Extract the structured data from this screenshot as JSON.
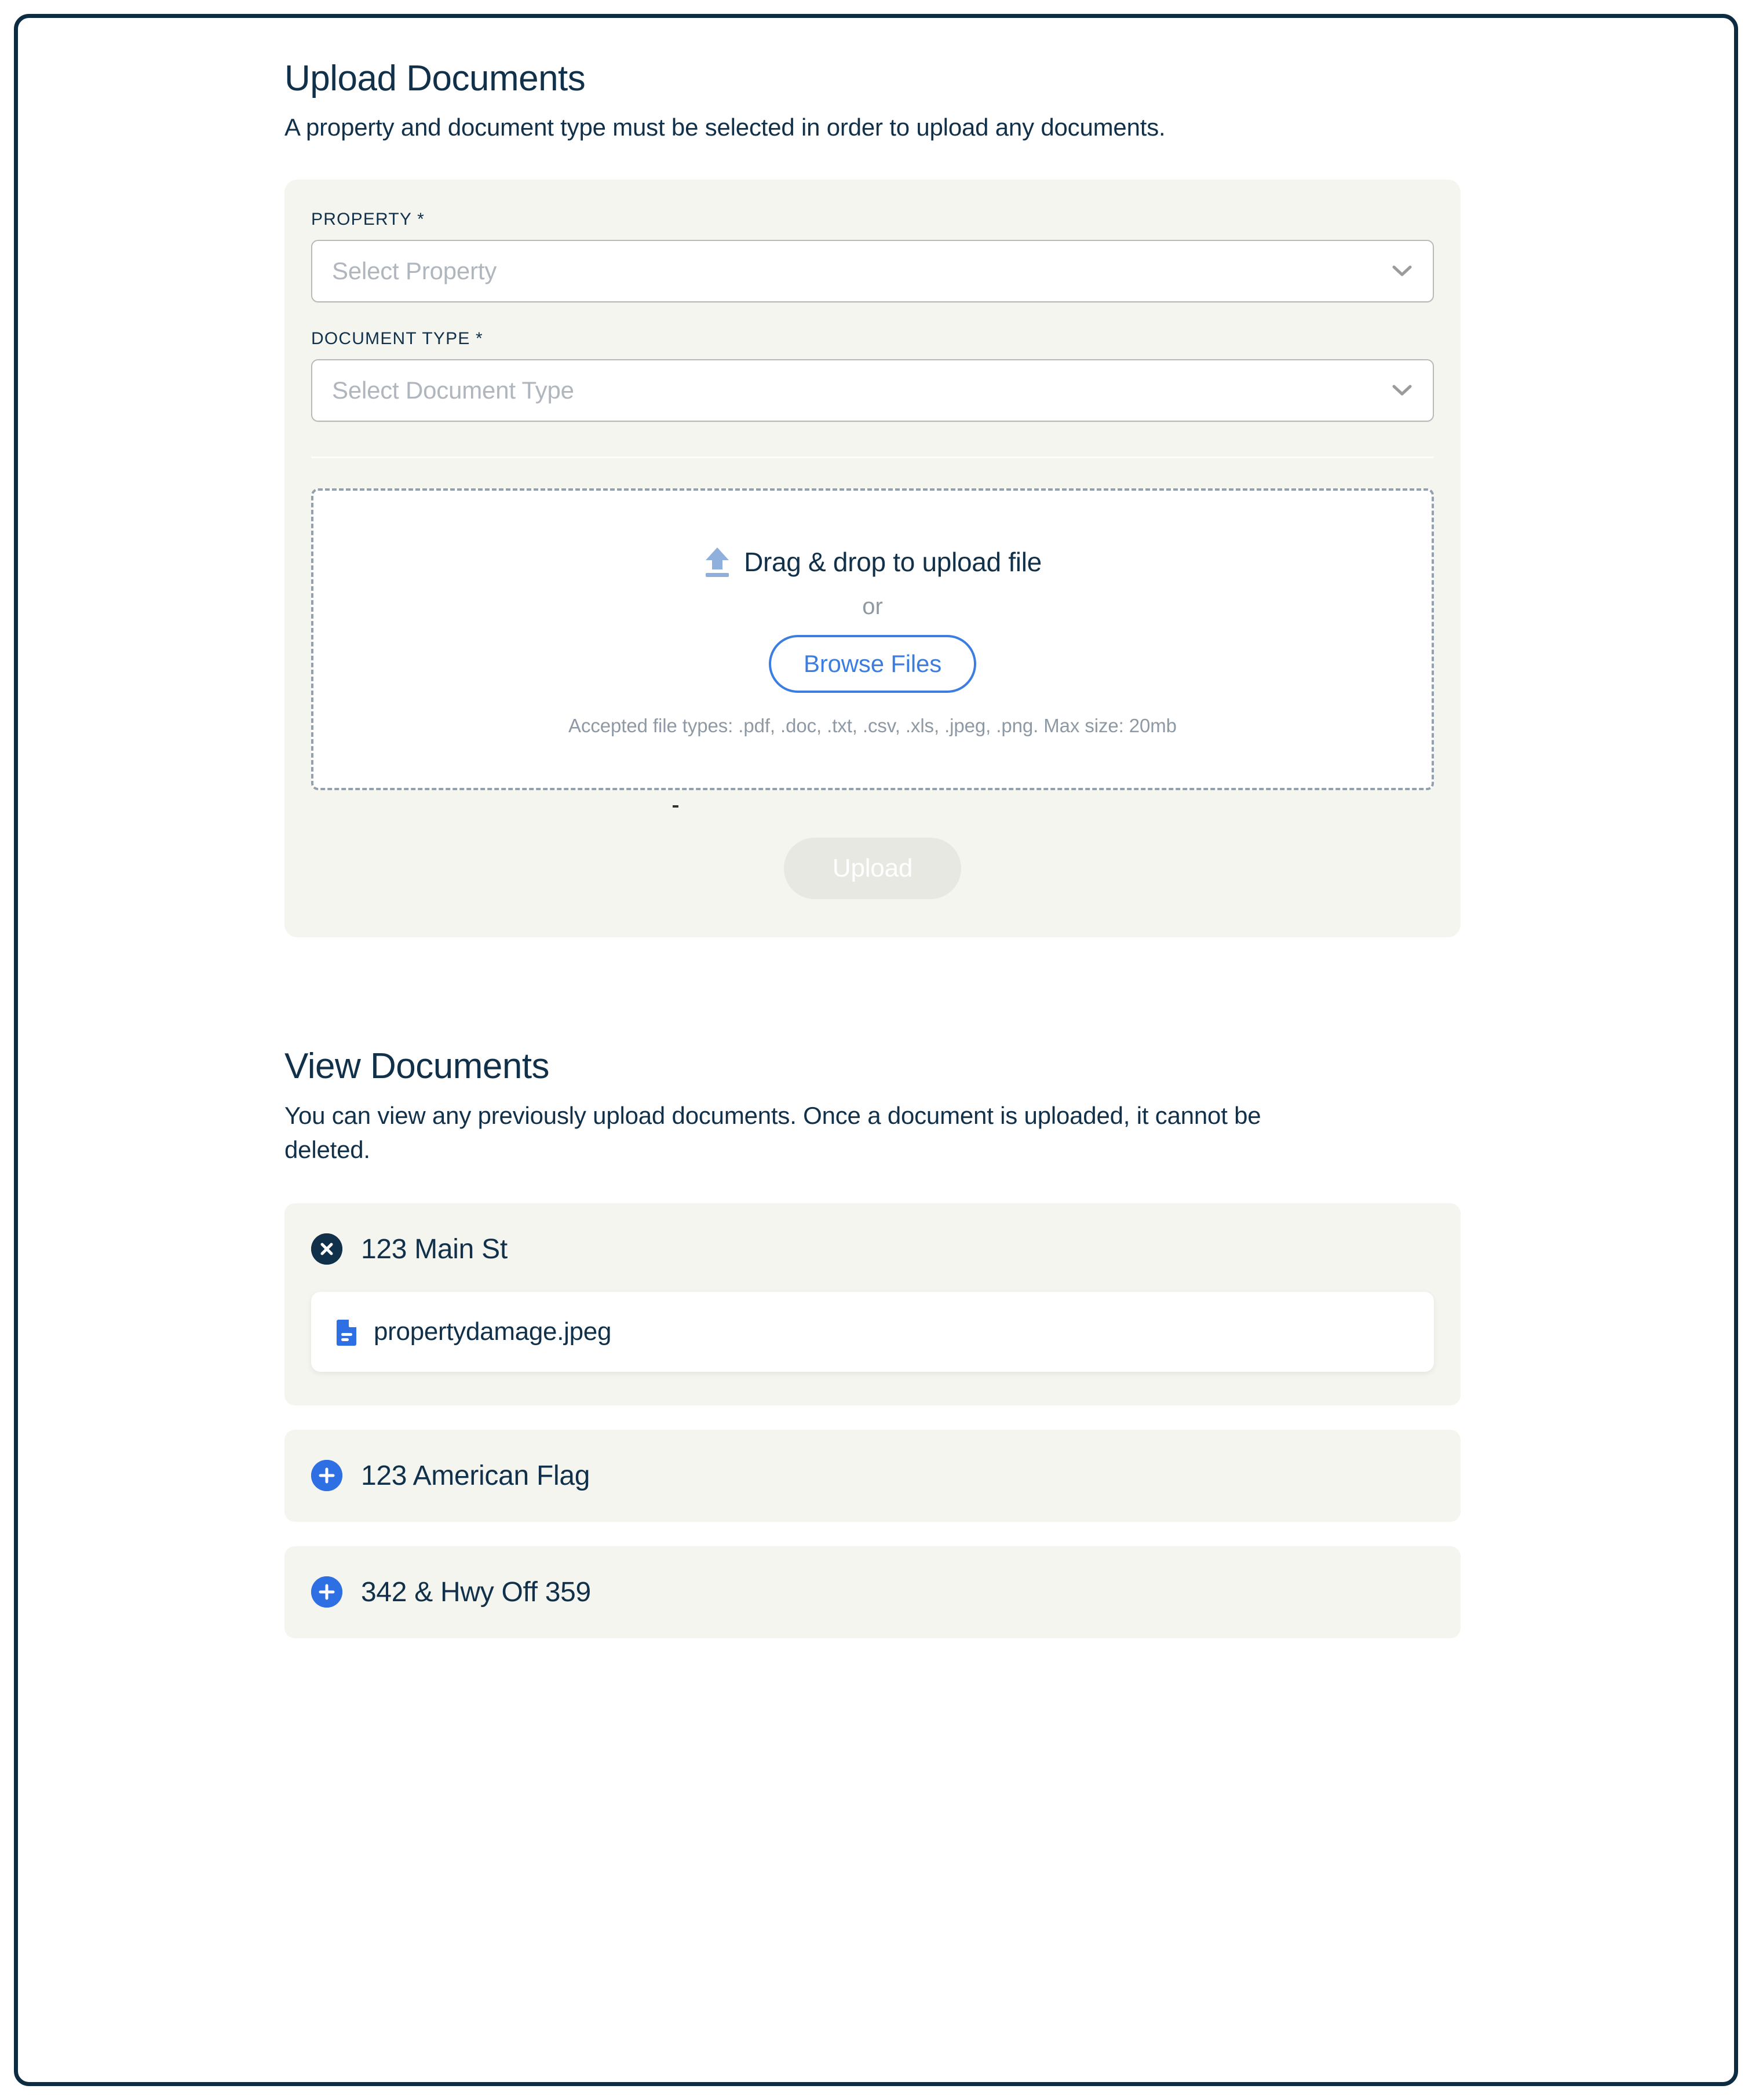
{
  "colors": {
    "frame_border": "#0d2c42",
    "navy_text": "#11304a",
    "card_bg": "#f5f5ef",
    "accent_blue": "#3b7de0",
    "icon_blue": "#2f6fe4",
    "upload_arrow_blue": "#8fb0dd",
    "muted_gray": "#8e99a4",
    "placeholder_gray": "#b0b6bd",
    "disabled_btn_bg": "#e8e8e3"
  },
  "upload_section": {
    "title": "Upload Documents",
    "subtitle": "A property and document type must be selected in order to upload any documents.",
    "property_field": {
      "label": "PROPERTY *",
      "placeholder": "Select Property",
      "value": ""
    },
    "document_type_field": {
      "label": "DOCUMENT TYPE *",
      "placeholder": "Select Document Type",
      "value": ""
    },
    "dropzone": {
      "icon": "upload-arrow-icon",
      "title": "Drag & drop to upload file",
      "or_label": "or",
      "browse_label": "Browse Files",
      "accepted_note": "Accepted file types: .pdf, .doc, .txt, .csv, .xls, .jpeg, .png. Max size: 20mb"
    },
    "submit_label": "Upload",
    "submit_disabled": true
  },
  "view_section": {
    "title": "View Documents",
    "subtitle": "You can view any previously upload documents. Once a document is uploaded, it cannot be deleted.",
    "properties": [
      {
        "name": "123 Main St",
        "expanded": true,
        "toggle_icon": "close-circle-icon",
        "documents": [
          {
            "filename": "propertydamage.jpeg",
            "icon": "document-icon"
          }
        ]
      },
      {
        "name": "123 American Flag",
        "expanded": false,
        "toggle_icon": "plus-circle-icon",
        "documents": []
      },
      {
        "name": "342 & Hwy Off 359",
        "expanded": false,
        "toggle_icon": "plus-circle-icon",
        "documents": []
      }
    ]
  }
}
